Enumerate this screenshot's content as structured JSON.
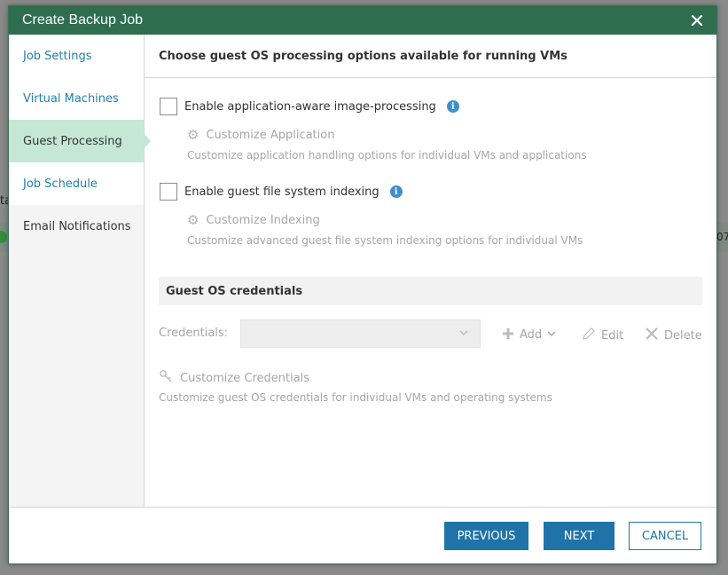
{
  "background": {
    "left_fragment": "ta",
    "right_fragment": "07"
  },
  "dialog": {
    "title": "Create Backup Job",
    "close_icon": "close-icon"
  },
  "sidebar": {
    "items": [
      {
        "label": "Job Settings",
        "state": "link"
      },
      {
        "label": "Virtual Machines",
        "state": "link"
      },
      {
        "label": "Guest Processing",
        "state": "active"
      },
      {
        "label": "Job Schedule",
        "state": "link"
      },
      {
        "label": "Email Notifications",
        "state": "inactive"
      }
    ]
  },
  "main": {
    "header": "Choose guest OS processing options available for running VMs",
    "app_aware": {
      "label": "Enable application-aware image-processing",
      "checked": false,
      "customize_label": "Customize Application",
      "customize_desc": "Customize application handling options for individual VMs and applications"
    },
    "indexing": {
      "label": "Enable guest file system indexing",
      "checked": false,
      "customize_label": "Customize Indexing",
      "customize_desc": "Customize advanced guest file system indexing options for individual VMs"
    },
    "credentials": {
      "section_title": "Guest OS credentials",
      "label": "Credentials:",
      "selected_value": "",
      "add_label": "Add",
      "edit_label": "Edit",
      "delete_label": "Delete",
      "customize_label": "Customize Credentials",
      "customize_desc": "Customize guest OS credentials for individual VMs and operating systems"
    }
  },
  "footer": {
    "previous_label": "PREVIOUS",
    "next_label": "NEXT",
    "cancel_label": "CANCEL"
  },
  "colors": {
    "titlebar": "#2e6e4f",
    "active_nav": "#c5e8d4",
    "link": "#1f7fae",
    "primary_button": "#1f73a8"
  }
}
